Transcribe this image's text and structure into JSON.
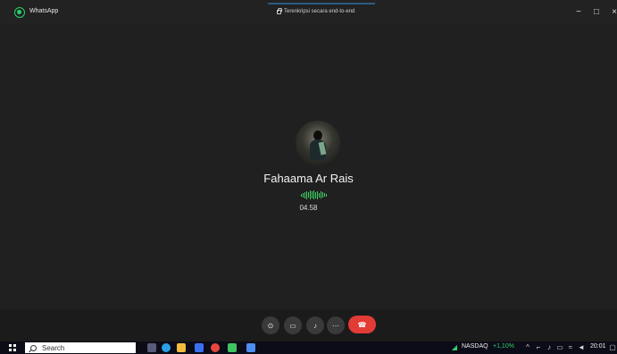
{
  "window": {
    "title": "WhatsApp",
    "encryption_text": "Terenkripsi secara end-to-end",
    "controls": [
      "−",
      "□",
      "×"
    ]
  },
  "call": {
    "contact_name": "Fahaama Ar Rais",
    "duration": "04.58",
    "avatar_icon": "contact-avatar",
    "voice_wave_color": "#3ecf62",
    "controls": [
      {
        "name": "share-screen-button",
        "icon": "share-screen-icon",
        "glyph": "⊙"
      },
      {
        "name": "video-button",
        "icon": "camera-off-icon",
        "glyph": "▭"
      },
      {
        "name": "microphone-button",
        "icon": "microphone-icon",
        "glyph": "♪"
      },
      {
        "name": "more-options-button",
        "icon": "more-icon",
        "glyph": "⋯"
      },
      {
        "name": "end-call-button",
        "icon": "phone-hangup-icon",
        "glyph": "☎"
      }
    ]
  },
  "taskbar": {
    "search_label": "Search",
    "stock_label": "NASDAQ",
    "stock_change": "+1,10%",
    "time": "20:01",
    "stock_change_color": "#2fcf69"
  },
  "colors": {
    "title_bar": "#222222",
    "call_background": "#202020",
    "end_call": "#e33b35",
    "taskbar": "#0c0c18"
  }
}
